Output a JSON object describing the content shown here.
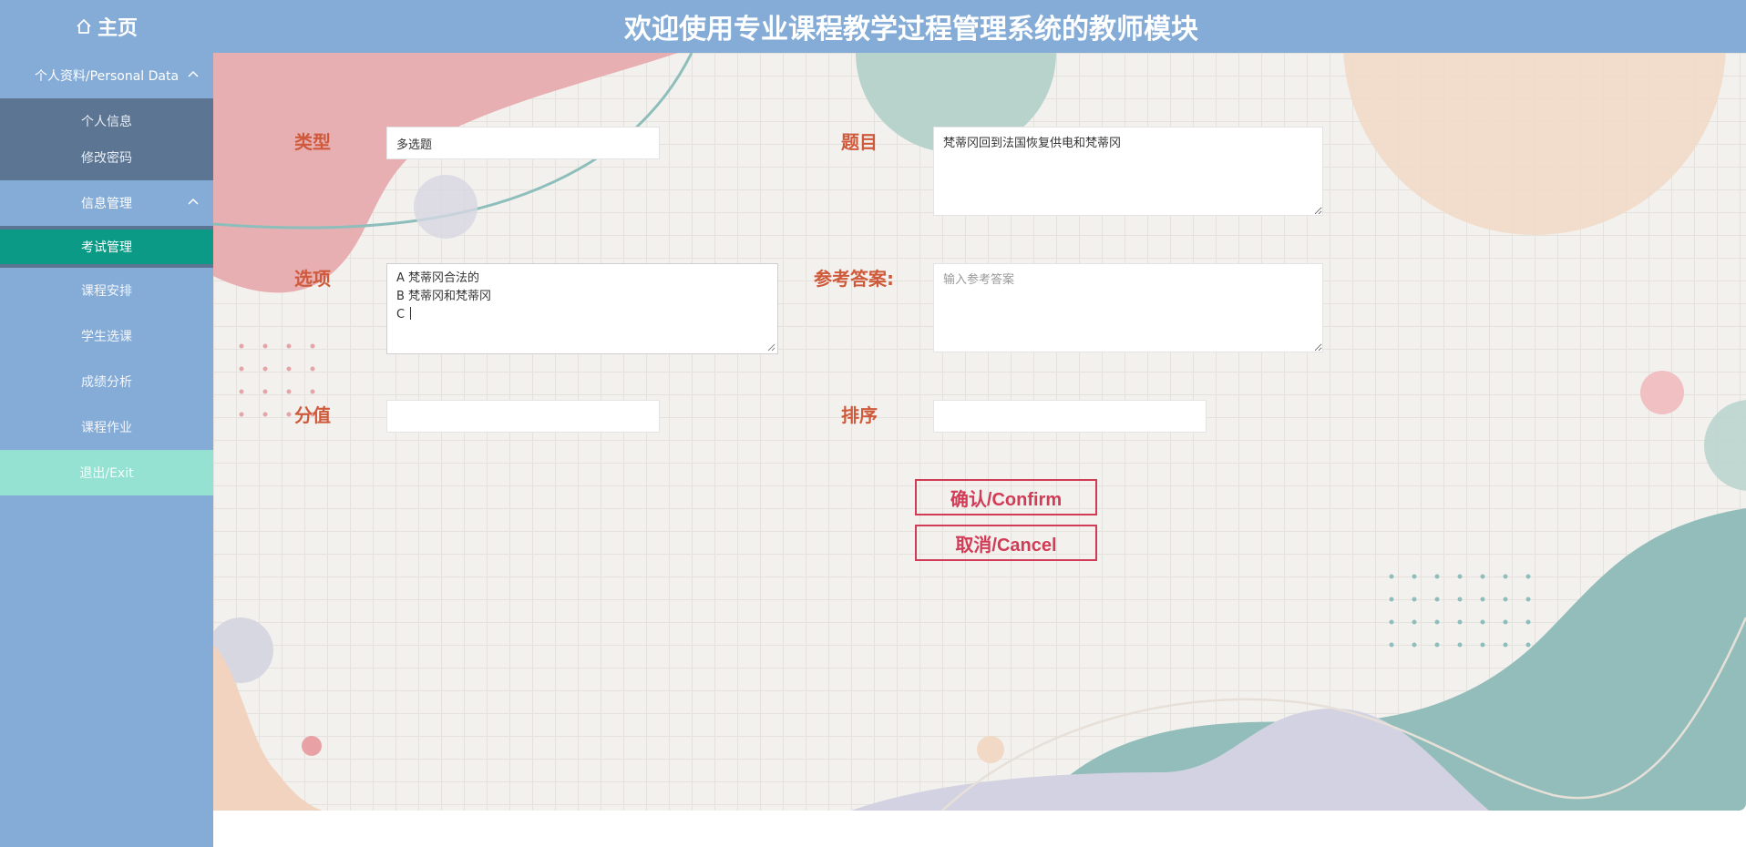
{
  "header": {
    "home_label": "主页",
    "title": "欢迎使用专业课程教学过程管理系统的教师模块"
  },
  "sidebar": {
    "group1": {
      "label": "个人资料/Personal Data",
      "items": [
        "个人信息",
        "修改密码"
      ]
    },
    "group2": {
      "label": "信息管理",
      "active_item": "考试管理"
    },
    "items": [
      "课程安排",
      "学生选课",
      "成绩分析",
      "课程作业"
    ],
    "exit_label": "退出/Exit"
  },
  "form": {
    "type_label": "类型",
    "type_value": "多选题",
    "question_label": "题目",
    "question_value": "梵蒂冈回到法国恢复供电和梵蒂冈",
    "options_label": "选项",
    "options_lines": [
      "A 梵蒂冈合法的",
      "B 梵蒂冈和梵蒂冈",
      "C "
    ],
    "answer_label": "参考答案:",
    "answer_placeholder": "输入参考答案",
    "score_label": "分值",
    "score_value": "",
    "sort_label": "排序",
    "sort_value": "",
    "confirm_label": "确认/Confirm",
    "cancel_label": "取消/Cancel"
  },
  "colors": {
    "header_bg": "#84acd7",
    "sidebar_dark": "#5c7592",
    "active_item": "#0b9a86",
    "exit_bg": "#95e2d3",
    "label_color": "#cf5a3b",
    "button_color": "#d13b55"
  },
  "icons": {
    "home": "home-icon",
    "chevron": "chevron-up-icon"
  }
}
